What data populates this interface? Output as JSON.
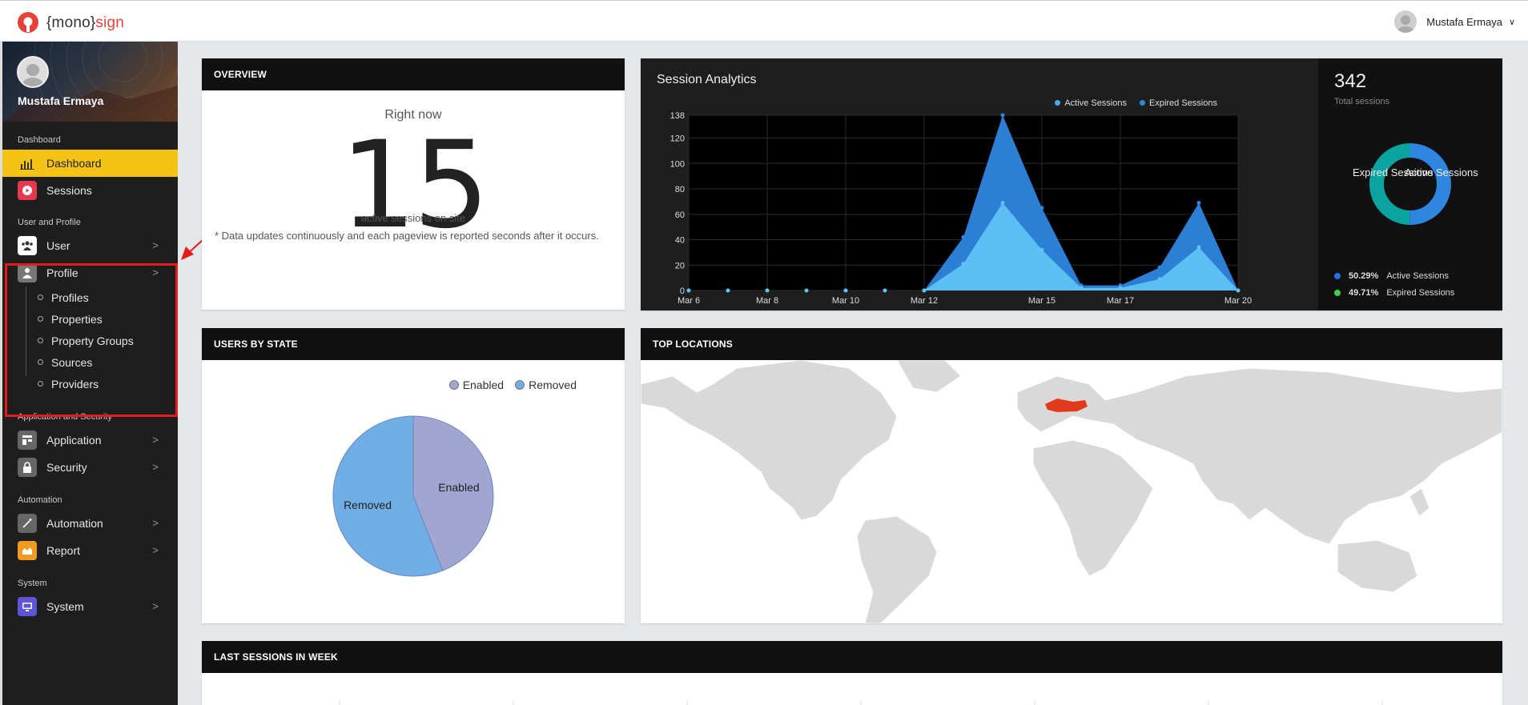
{
  "brand": {
    "open": "{mono}",
    "accent": "sign"
  },
  "user": {
    "name": "Mustafa Ermaya"
  },
  "sidebar": {
    "profile_name": "Mustafa Ermaya",
    "sections": [
      {
        "title": "Dashboard"
      },
      {
        "title": "User and Profile"
      },
      {
        "title": "Application and Security"
      },
      {
        "title": "Automation"
      },
      {
        "title": "System"
      }
    ],
    "items": {
      "dashboard": "Dashboard",
      "sessions": "Sessions",
      "user": "User",
      "profile": "Profile",
      "application": "Application",
      "security": "Security",
      "automation": "Automation",
      "report": "Report",
      "system": "System"
    },
    "profile_sub": [
      "Profiles",
      "Properties",
      "Property Groups",
      "Sources",
      "Providers"
    ]
  },
  "overview": {
    "header": "OVERVIEW",
    "right_now": "Right now",
    "count": "15",
    "caption": "active sessions on site",
    "note": "* Data updates continuously and each pageview is reported seconds after it occurs."
  },
  "analytics": {
    "title": "Session Analytics",
    "total": "342",
    "total_label": "Total sessions",
    "legend": [
      {
        "label": "Active Sessions",
        "color": "#4aa7f0"
      },
      {
        "label": "Expired Sessions",
        "color": "#2f86e0"
      }
    ],
    "breakdown": [
      {
        "pct": "50.29%",
        "label": "Active Sessions",
        "color": "#1e73e8"
      },
      {
        "pct": "49.71%",
        "label": "Expired Sessions",
        "color": "#3ccf4e"
      }
    ],
    "donut_labels": {
      "left": "Expired Sessions",
      "right": "Active Sessions"
    }
  },
  "chart_data": [
    {
      "type": "area",
      "x": [
        "Mar 6",
        "Mar 7",
        "Mar 8",
        "Mar 9",
        "Mar 10",
        "Mar 11",
        "Mar 12",
        "Mar 13",
        "Mar 14",
        "Mar 15",
        "Mar 16",
        "Mar 17",
        "Mar 18",
        "Mar 19",
        "Mar 20"
      ],
      "x_ticks": [
        "Mar 6",
        "Mar 8",
        "Mar 10",
        "Mar 12",
        "Mar 15",
        "Mar 17",
        "Mar 20"
      ],
      "y_ticks": [
        0,
        20,
        40,
        60,
        80,
        100,
        120,
        138
      ],
      "ylim": [
        0,
        138
      ],
      "series": [
        {
          "name": "Expired Sessions",
          "values": [
            0,
            0,
            0,
            0,
            0,
            0,
            0,
            42,
            138,
            65,
            4,
            4,
            18,
            69,
            0
          ]
        },
        {
          "name": "Active Sessions",
          "values": [
            0,
            0,
            0,
            0,
            0,
            0,
            0,
            21,
            69,
            32,
            2,
            2,
            9,
            34,
            0
          ]
        }
      ]
    },
    {
      "type": "pie",
      "title": "Total sessions",
      "categories": [
        "Active Sessions",
        "Expired Sessions"
      ],
      "values": [
        50.29,
        49.71
      ]
    },
    {
      "type": "pie",
      "title": "USERS BY STATE",
      "categories": [
        "Enabled",
        "Removed"
      ],
      "values": [
        44,
        56
      ]
    }
  ],
  "users_by_state": {
    "header": "USERS BY STATE",
    "legend": [
      {
        "label": "Enabled",
        "color": "#a0a5d2"
      },
      {
        "label": "Removed",
        "color": "#72aee6"
      }
    ],
    "slice_labels": {
      "enabled": "Enabled",
      "removed": "Removed"
    }
  },
  "top_locations": {
    "header": "TOP LOCATIONS",
    "highlight_color": "#e23a1a"
  },
  "last_sessions": {
    "header": "LAST SESSIONS IN WEEK"
  }
}
